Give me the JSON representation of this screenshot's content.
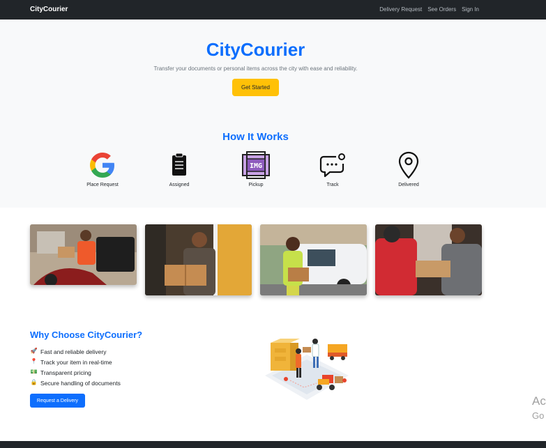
{
  "navbar": {
    "brand": "CityCourier",
    "links": [
      "Delivery Request",
      "See Orders",
      "Sign In"
    ]
  },
  "hero": {
    "title": "CityCourier",
    "subtitle": "Transfer your documents or personal items across the city with ease and reliability.",
    "cta_label": "Get Started"
  },
  "how_it_works": {
    "title": "How It Works",
    "steps": [
      {
        "label": "Place Request",
        "icon": "google-icon"
      },
      {
        "label": "Assigned",
        "icon": "clipboard-icon"
      },
      {
        "label": "Pickup",
        "icon": "img-icon"
      },
      {
        "label": "Track",
        "icon": "chat-bubble-icon"
      },
      {
        "label": "Delivered",
        "icon": "location-pin-icon"
      }
    ]
  },
  "why": {
    "title": "Why Choose CityCourier?",
    "features": [
      {
        "icon": "🚀",
        "text": "Fast and reliable delivery"
      },
      {
        "icon": "📍",
        "text": "Track your item in real-time"
      },
      {
        "icon": "💵",
        "text": "Transparent pricing"
      },
      {
        "icon": "🔒",
        "text": "Secure handling of documents"
      }
    ],
    "button_label": "Request a Delivery"
  },
  "watermark": {
    "line1": "Ac",
    "line2": "Go"
  },
  "colors": {
    "accent": "#0d6efd",
    "cta": "#ffc107",
    "dark": "#212529"
  }
}
